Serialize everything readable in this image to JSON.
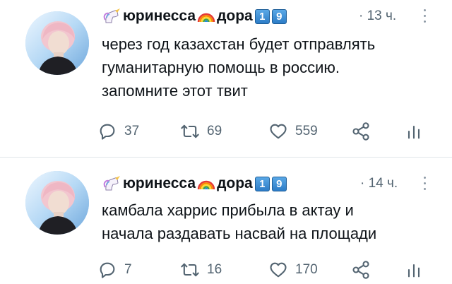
{
  "tweets": [
    {
      "display_name": "юринесса",
      "display_name_2": "дора",
      "badges": [
        "1",
        "9"
      ],
      "emojis": [
        "unicorn",
        "rainbow"
      ],
      "time": "· 13 ч.",
      "text": "через год казахстан будет отправлять\nгуманитарную помощь в россию.\nзапомните этот твит",
      "replies": "37",
      "retweets": "69",
      "likes": "559",
      "icons": [
        "reply-icon",
        "retweet-icon",
        "like-icon",
        "share-icon",
        "stats-icon",
        "more-icon"
      ]
    },
    {
      "display_name": "юринесса",
      "display_name_2": "дора",
      "badges": [
        "1",
        "9"
      ],
      "emojis": [
        "unicorn",
        "rainbow"
      ],
      "time": "· 14 ч.",
      "text": "камбала харрис прибыла в актау и\nначала раздавать насвай на площади",
      "replies": "7",
      "retweets": "16",
      "likes": "170",
      "icons": [
        "reply-icon",
        "retweet-icon",
        "like-icon",
        "share-icon",
        "stats-icon",
        "more-icon"
      ]
    }
  ],
  "colors": {
    "text": "#0f1419",
    "secondary": "#536471",
    "divider": "#e1e6ea",
    "badge": "#2c7cc7"
  }
}
